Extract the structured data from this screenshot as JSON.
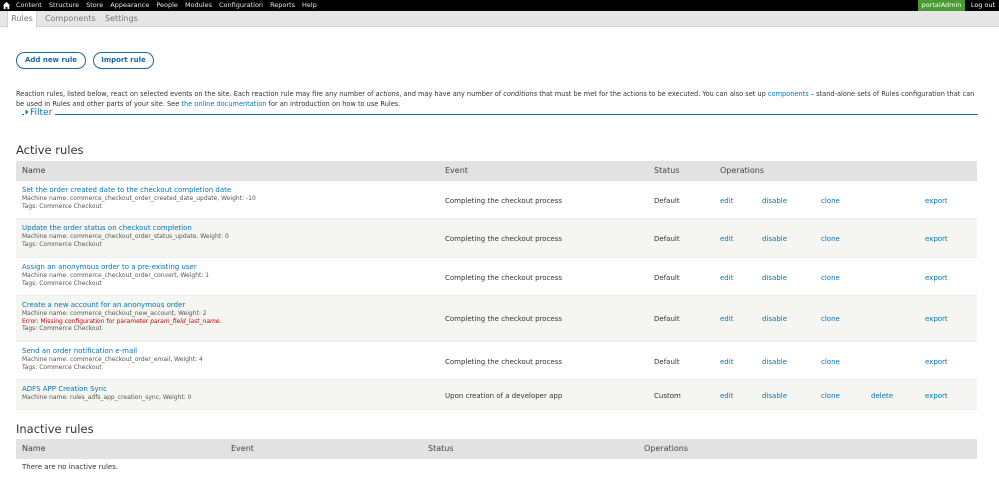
{
  "toolbar": {
    "items": [
      "Content",
      "Structure",
      "Store",
      "Appearance",
      "People",
      "Modules",
      "Configuration",
      "Reports",
      "Help"
    ],
    "user": "portalAdmin",
    "logout": "Log out"
  },
  "tabs": [
    "Rules",
    "Components",
    "Settings"
  ],
  "buttons": {
    "add": "Add new rule",
    "import": "Import rule"
  },
  "description": {
    "p1": "Reaction rules, listed below, react on selected events on the site. Each reaction rule may fire any number of ",
    "actions": "actions",
    "p2": ", and may have any number of ",
    "conditions": "conditions",
    "p3": " that must be met for the actions to be executed. You can also set up ",
    "components": "components",
    "p4": " – stand-alone sets of Rules configuration that can be used in Rules and other parts of your site. See ",
    "docs": "the online documentation",
    "p5": " for an introduction on how to use Rules."
  },
  "filter": {
    "label": "Filter"
  },
  "active": {
    "title": "Active rules",
    "headers": {
      "name": "Name",
      "event": "Event",
      "status": "Status",
      "operations": "Operations"
    },
    "rows": [
      {
        "name": "Set the order created date to the checkout completion date",
        "machine": "Machine name: commerce_checkout_order_created_date_update, Weight: -10",
        "tags": "Tags: Commerce Checkout",
        "event": "Completing the checkout process",
        "status": "Default",
        "ops": [
          "edit",
          "disable",
          "clone",
          "",
          "export"
        ]
      },
      {
        "name": "Update the order status on checkout completion",
        "machine": "Machine name: commerce_checkout_order_status_update, Weight: 0",
        "tags": "Tags: Commerce Checkout",
        "event": "Completing the checkout process",
        "status": "Default",
        "ops": [
          "edit",
          "disable",
          "clone",
          "",
          "export"
        ]
      },
      {
        "name": "Assign an anonymous order to a pre-existing user",
        "machine": "Machine name: commerce_checkout_order_convert, Weight: 1",
        "tags": "Tags: Commerce Checkout",
        "event": "Completing the checkout process",
        "status": "Default",
        "ops": [
          "edit",
          "disable",
          "clone",
          "",
          "export"
        ]
      },
      {
        "name": "Create a new account for an anonymous order",
        "machine": "Machine name: commerce_checkout_new_account, Weight: 2",
        "error_prefix": "Error: Missing configuration for parameter ",
        "error_param": "param_field_last_name",
        "error_suffix": ".",
        "tags": "Tags: Commerce Checkout",
        "event": "Completing the checkout process",
        "status": "Default",
        "ops": [
          "edit",
          "disable",
          "clone",
          "",
          "export"
        ]
      },
      {
        "name": "Send an order notification e-mail",
        "machine": "Machine name: commerce_checkout_order_email, Weight: 4",
        "tags": "Tags: Commerce Checkout",
        "event": "Completing the checkout process",
        "status": "Default",
        "ops": [
          "edit",
          "disable",
          "clone",
          "",
          "export"
        ]
      },
      {
        "name": "ADFS APP Creation Sync",
        "machine": "Machine name: rules_adfs_app_creation_sync, Weight: 0",
        "event": "Upon creation of a developer app",
        "status": "Custom",
        "ops": [
          "edit",
          "disable",
          "clone",
          "delete",
          "export"
        ]
      }
    ]
  },
  "inactive": {
    "title": "Inactive rules",
    "headers": {
      "name": "Name",
      "event": "Event",
      "status": "Status",
      "operations": "Operations"
    },
    "empty": "There are no inactive rules."
  },
  "colors": {
    "link": "#0074bd",
    "toolbar": "#000000",
    "user_badge": "#4a9b2f",
    "error": "#c30000"
  },
  "icons": {
    "home": "home-icon",
    "filter_toggle": "triangle-right-icon"
  }
}
